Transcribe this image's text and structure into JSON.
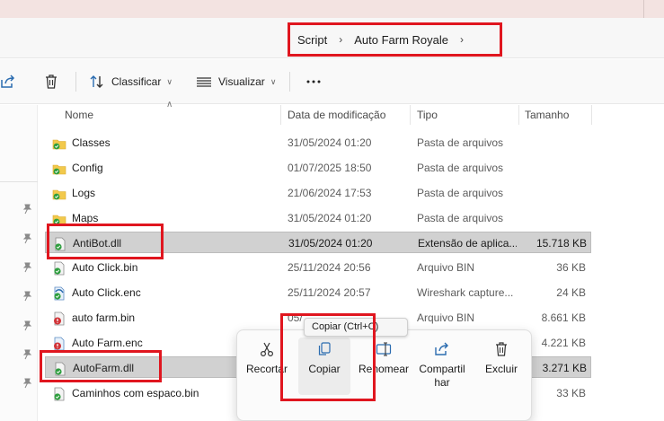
{
  "breadcrumb": {
    "items": [
      "Script",
      "Auto Farm Royale"
    ]
  },
  "toolbar": {
    "sort_label": "Classificar",
    "view_label": "Visualizar"
  },
  "columns": {
    "name": "Nome",
    "date": "Data de modificação",
    "type": "Tipo",
    "size": "Tamanho"
  },
  "files": [
    {
      "name": "Classes",
      "date": "31/05/2024 01:20",
      "type": "Pasta de arquivos",
      "size": "",
      "icon": "folder-icon"
    },
    {
      "name": "Config",
      "date": "01/07/2025 18:50",
      "type": "Pasta de arquivos",
      "size": "",
      "icon": "folder-icon"
    },
    {
      "name": "Logs",
      "date": "21/06/2024 17:53",
      "type": "Pasta de arquivos",
      "size": "",
      "icon": "folder-icon"
    },
    {
      "name": "Maps",
      "date": "31/05/2024 01:20",
      "type": "Pasta de arquivos",
      "size": "",
      "icon": "folder-icon"
    },
    {
      "name": "AntiBot.dll",
      "date": "31/05/2024 01:20",
      "type": "Extensão de aplica...",
      "size": "15.718 KB",
      "icon": "dll-file-icon"
    },
    {
      "name": "Auto Click.bin",
      "date": "25/11/2024 20:56",
      "type": "Arquivo BIN",
      "size": "36 KB",
      "icon": "file-icon"
    },
    {
      "name": "Auto Click.enc",
      "date": "25/11/2024 20:57",
      "type": "Wireshark capture...",
      "size": "24 KB",
      "icon": "wireshark-file-icon"
    },
    {
      "name": "auto farm.bin",
      "date": "05/",
      "type": "Arquivo BIN",
      "size": "8.661 KB",
      "icon": "warning-file-icon"
    },
    {
      "name": "Auto Farm.enc",
      "date": "",
      "type": "",
      "size": "4.221 KB",
      "icon": "warning-file-icon"
    },
    {
      "name": "AutoFarm.dll",
      "date": "",
      "type": "",
      "size": "3.271 KB",
      "icon": "dll-file-icon"
    },
    {
      "name": "Caminhos com espaco.bin",
      "date": "",
      "type": "",
      "size": "33 KB",
      "icon": "file-icon"
    }
  ],
  "tooltip": {
    "text": "Copiar (Ctrl+C)"
  },
  "context_menu": {
    "cut": "Recortar",
    "copy": "Copiar",
    "rename": "Renomear",
    "share_line1": "Compartil",
    "share_line2": "har",
    "delete": "Excluir"
  },
  "colors": {
    "highlight": "#e0161f",
    "selection": "#d1d1d1",
    "title_strip": "#f3e3e1"
  }
}
